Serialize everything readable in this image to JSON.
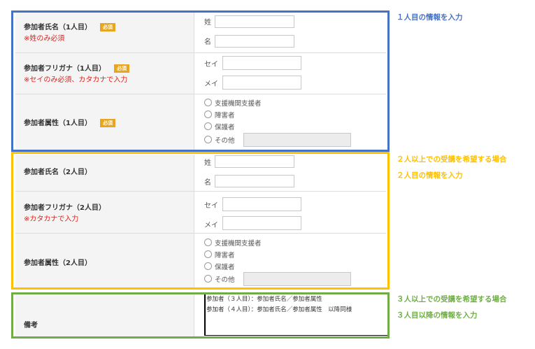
{
  "required_badge": "必須",
  "person1": {
    "name_label": "参加者氏名（1人目）",
    "name_note": "※姓のみ必須",
    "surname_label": "姓",
    "givenname_label": "名",
    "kana_label": "参加者フリガナ（1人目）",
    "kana_note": "※セイのみ必須、カタカナで入力",
    "sei_label": "セイ",
    "mei_label": "メイ",
    "attr_label": "参加者属性（1人目）",
    "attr_options": [
      "支援機関支援者",
      "障害者",
      "保護者",
      "その他"
    ]
  },
  "person2": {
    "name_label": "参加者氏名（2人目）",
    "surname_label": "姓",
    "givenname_label": "名",
    "kana_label": "参加者フリガナ（2人目）",
    "kana_note": "※カタカナで入力",
    "sei_label": "セイ",
    "mei_label": "メイ",
    "attr_label": "参加者属性（2人目）",
    "attr_options": [
      "支援機関支援者",
      "障害者",
      "保護者",
      "その他"
    ]
  },
  "remarks": {
    "label": "備考",
    "lines": [
      "参加者（３人目）：参加者氏名／参加者属性",
      "参加者（４人目）：参加者氏名／参加者属性　以降同様"
    ]
  },
  "annotations": {
    "blue_line1": "１人目の情報を入力",
    "yellow_line1": "２人以上での受講を希望する場合",
    "yellow_line2": "２人目の情報を入力",
    "green_line1": "３人以上での受講を希望する場合",
    "green_line2": "３人目以降の情報を入力"
  },
  "colors": {
    "blue_frame": "#4472c4",
    "yellow_frame": "#ffc000",
    "green_frame": "#70ad47",
    "required_badge": "#e7a521",
    "note_red": "#e0201b"
  }
}
